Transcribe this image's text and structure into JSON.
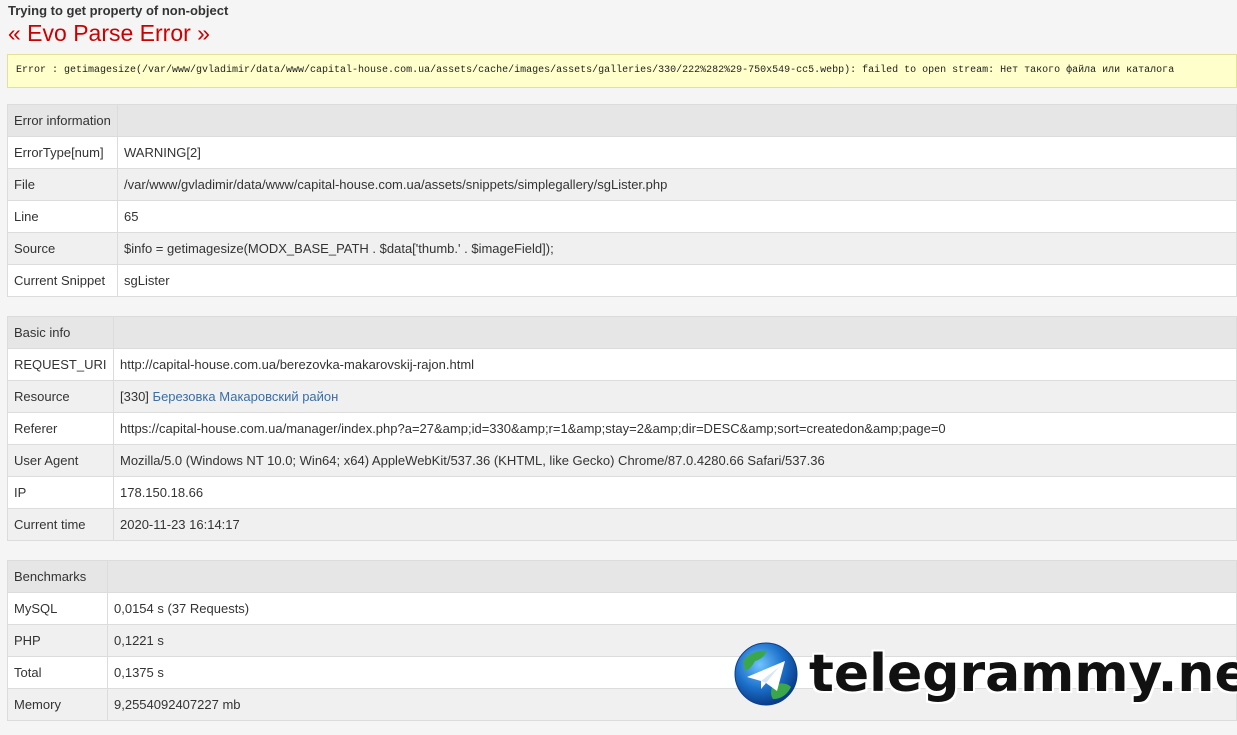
{
  "notice": "Trying to get property of non-object",
  "title": "« Evo Parse Error »",
  "error_message": "Error : getimagesize(/var/www/gvladimir/data/www/capital-house.com.ua/assets/cache/images/assets/galleries/330/222%282%29-750x549-cc5.webp): failed to open stream: Нет такого файла или каталога",
  "error_info": {
    "header": "Error information",
    "rows": [
      {
        "label": "ErrorType[num]",
        "value": "WARNING[2]"
      },
      {
        "label": "File",
        "value": "/var/www/gvladimir/data/www/capital-house.com.ua/assets/snippets/simplegallery/sgLister.php"
      },
      {
        "label": "Line",
        "value": "65"
      },
      {
        "label": "Source",
        "value": "$info = getimagesize(MODX_BASE_PATH . $data['thumb.' . $imageField]);"
      },
      {
        "label": "Current Snippet",
        "value": "sgLister"
      }
    ]
  },
  "basic_info": {
    "header": "Basic info",
    "request_uri": {
      "label": "REQUEST_URI",
      "value": "http://capital-house.com.ua/berezovka-makarovskij-rajon.html"
    },
    "resource": {
      "label": "Resource",
      "prefix": "[330]",
      "link": "Березовка Макаровский район"
    },
    "referer": {
      "label": "Referer",
      "value": "https://capital-house.com.ua/manager/index.php?a=27&amp;id=330&amp;r=1&amp;stay=2&amp;dir=DESC&amp;sort=createdon&amp;page=0"
    },
    "user_agent": {
      "label": "User Agent",
      "value": "Mozilla/5.0 (Windows NT 10.0; Win64; x64) AppleWebKit/537.36 (KHTML, like Gecko) Chrome/87.0.4280.66 Safari/537.36"
    },
    "ip": {
      "label": "IP",
      "value": "178.150.18.66"
    },
    "current_time": {
      "label": "Current time",
      "value": "2020-11-23 16:14:17"
    }
  },
  "benchmarks": {
    "header": "Benchmarks",
    "rows": [
      {
        "label": "MySQL",
        "value": "0,0154 s (37 Requests)"
      },
      {
        "label": "PHP",
        "value": "0,1221 s"
      },
      {
        "label": "Total",
        "value": "0,1375 s"
      },
      {
        "label": "Memory",
        "value": "9,2554092407227 mb"
      }
    ]
  },
  "watermark": {
    "text": "telegrammy.net",
    "icon": "telegram-globe-icon",
    "colors": {
      "globe_blue": "#1b6fc9",
      "globe_green": "#3aa84a",
      "plane": "#ffffff"
    }
  }
}
